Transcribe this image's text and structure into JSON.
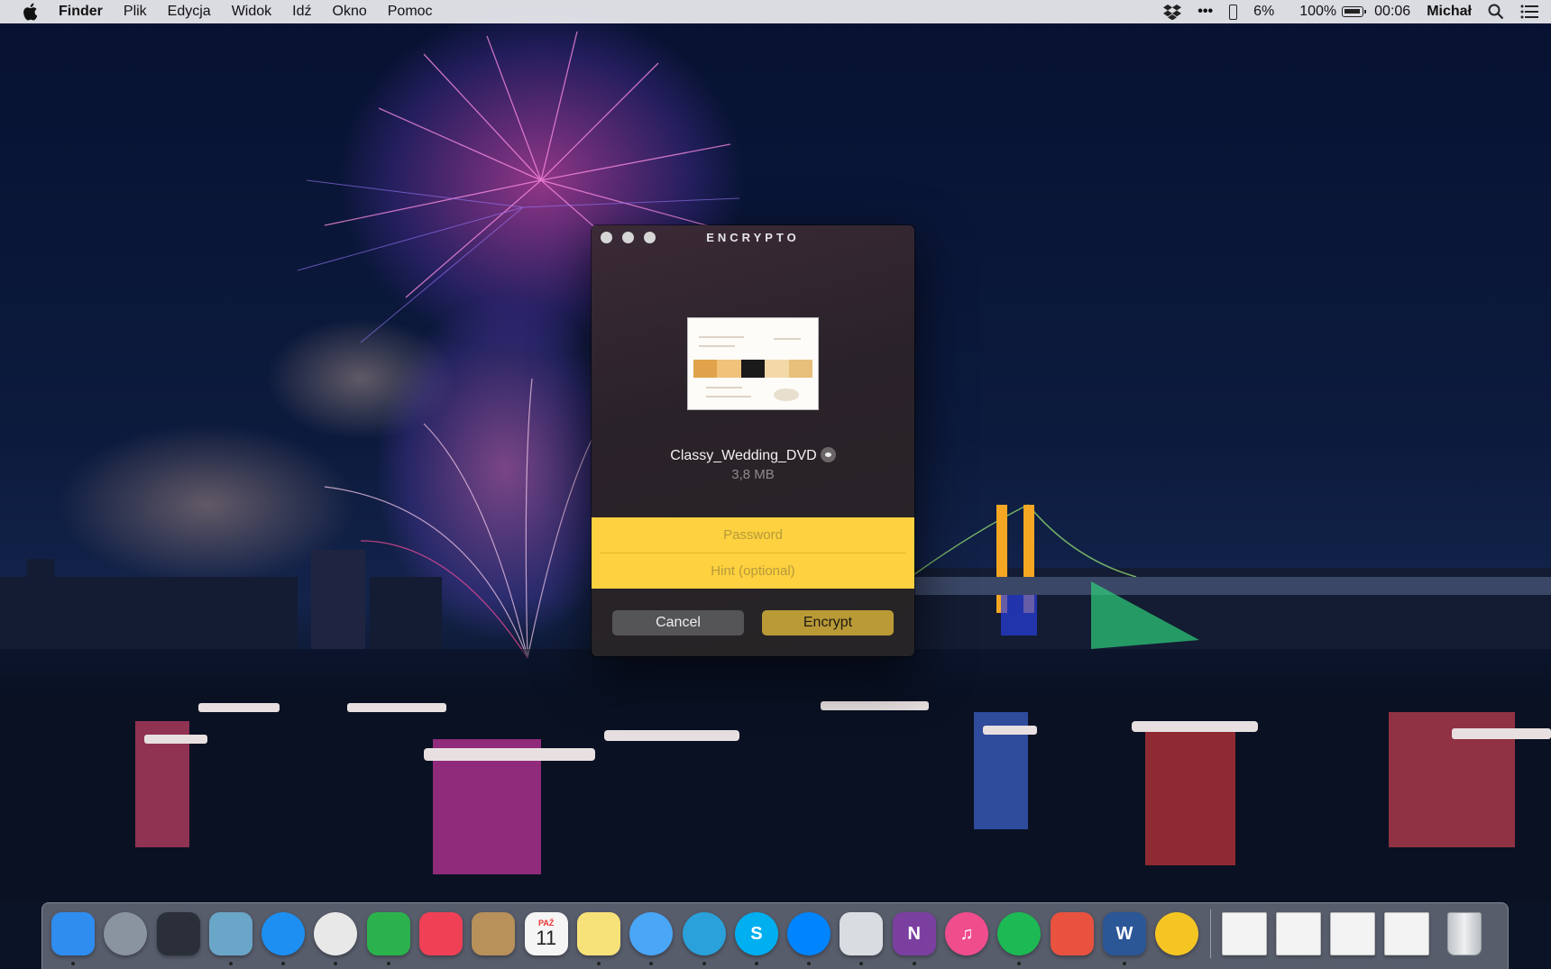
{
  "menubar": {
    "app_name": "Finder",
    "menus": [
      "Plik",
      "Edycja",
      "Widok",
      "Idź",
      "Okno",
      "Pomoc"
    ],
    "status": {
      "dots": "•••",
      "cpu_percent": "6%",
      "battery_percent": "100%",
      "time": "00:06",
      "user": "Michał"
    },
    "icons": [
      "apple-icon",
      "dropbox-icon",
      "more-icon",
      "phone-icon",
      "battery-icon",
      "spotlight-search-icon",
      "notification-center-icon"
    ]
  },
  "window": {
    "title": "ENCRYPTO",
    "file_name": "Classy_Wedding_DVD",
    "file_size": "3,8 MB",
    "password_placeholder": "Password",
    "hint_placeholder": "Hint (optional)",
    "cancel_label": "Cancel",
    "encrypt_label": "Encrypt"
  },
  "dock": {
    "calendar_month": "PAŹ",
    "calendar_day": "11",
    "apps": [
      {
        "name": "finder-icon",
        "glyph": "",
        "color": "#2f8df0"
      },
      {
        "name": "launchpad-icon",
        "glyph": "",
        "color": "#8a93a0"
      },
      {
        "name": "mission-control-icon",
        "glyph": "",
        "color": "#2b2f3a"
      },
      {
        "name": "mail-icon",
        "glyph": "",
        "color": "#6aa6c8"
      },
      {
        "name": "safari-icon",
        "glyph": "",
        "color": "#1d8ff2"
      },
      {
        "name": "chrome-icon",
        "glyph": "",
        "color": "#e8e8e8"
      },
      {
        "name": "feedly-icon",
        "glyph": "",
        "color": "#2bb24c"
      },
      {
        "name": "pocket-icon",
        "glyph": "",
        "color": "#ef4056"
      },
      {
        "name": "contacts-icon",
        "glyph": "",
        "color": "#b8905a"
      },
      {
        "name": "calendar-icon",
        "glyph": "",
        "color": "#f5f5f5"
      },
      {
        "name": "notes-icon",
        "glyph": "",
        "color": "#f7e27a"
      },
      {
        "name": "messages-icon",
        "glyph": "",
        "color": "#4aa6f7"
      },
      {
        "name": "telegram-icon",
        "glyph": "",
        "color": "#2aa1da"
      },
      {
        "name": "skype-icon",
        "glyph": "S",
        "color": "#00aff0"
      },
      {
        "name": "messenger-icon",
        "glyph": "",
        "color": "#0084ff"
      },
      {
        "name": "preview-icon",
        "glyph": "",
        "color": "#d9dde2"
      },
      {
        "name": "onenote-icon",
        "glyph": "N",
        "color": "#7b3fa0"
      },
      {
        "name": "itunes-icon",
        "glyph": "♫",
        "color": "#f04d8c"
      },
      {
        "name": "spotify-icon",
        "glyph": "",
        "color": "#1db954"
      },
      {
        "name": "downloader-icon",
        "glyph": "",
        "color": "#e8523f"
      },
      {
        "name": "word-icon",
        "glyph": "W",
        "color": "#2b5797"
      },
      {
        "name": "encrypto-icon",
        "glyph": "",
        "color": "#f5c623"
      }
    ]
  }
}
